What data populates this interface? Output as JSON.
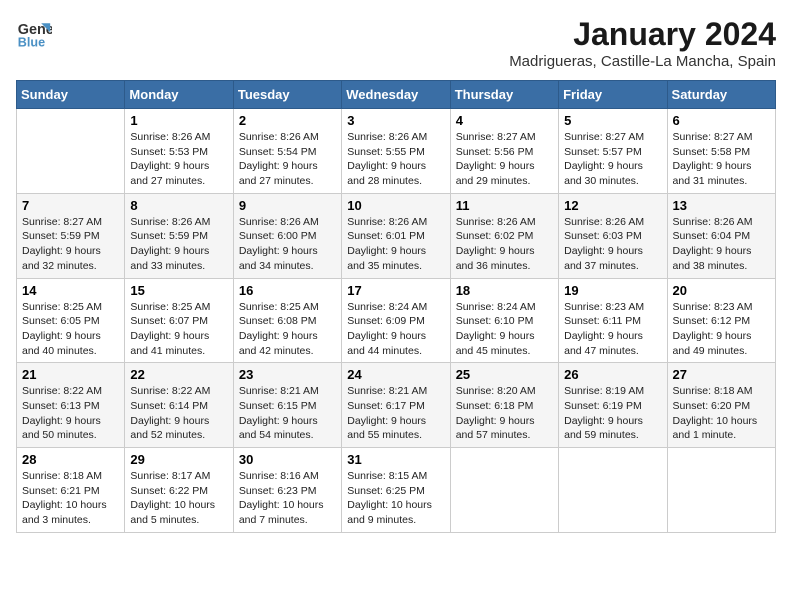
{
  "header": {
    "logo_line1": "General",
    "logo_line2": "Blue",
    "month": "January 2024",
    "location": "Madrigueras, Castille-La Mancha, Spain"
  },
  "days_of_week": [
    "Sunday",
    "Monday",
    "Tuesday",
    "Wednesday",
    "Thursday",
    "Friday",
    "Saturday"
  ],
  "weeks": [
    [
      {
        "day": "",
        "sunrise": "",
        "sunset": "",
        "daylight": ""
      },
      {
        "day": "1",
        "sunrise": "Sunrise: 8:26 AM",
        "sunset": "Sunset: 5:53 PM",
        "daylight": "Daylight: 9 hours and 27 minutes."
      },
      {
        "day": "2",
        "sunrise": "Sunrise: 8:26 AM",
        "sunset": "Sunset: 5:54 PM",
        "daylight": "Daylight: 9 hours and 27 minutes."
      },
      {
        "day": "3",
        "sunrise": "Sunrise: 8:26 AM",
        "sunset": "Sunset: 5:55 PM",
        "daylight": "Daylight: 9 hours and 28 minutes."
      },
      {
        "day": "4",
        "sunrise": "Sunrise: 8:27 AM",
        "sunset": "Sunset: 5:56 PM",
        "daylight": "Daylight: 9 hours and 29 minutes."
      },
      {
        "day": "5",
        "sunrise": "Sunrise: 8:27 AM",
        "sunset": "Sunset: 5:57 PM",
        "daylight": "Daylight: 9 hours and 30 minutes."
      },
      {
        "day": "6",
        "sunrise": "Sunrise: 8:27 AM",
        "sunset": "Sunset: 5:58 PM",
        "daylight": "Daylight: 9 hours and 31 minutes."
      }
    ],
    [
      {
        "day": "7",
        "sunrise": "Sunrise: 8:27 AM",
        "sunset": "Sunset: 5:59 PM",
        "daylight": "Daylight: 9 hours and 32 minutes."
      },
      {
        "day": "8",
        "sunrise": "Sunrise: 8:26 AM",
        "sunset": "Sunset: 5:59 PM",
        "daylight": "Daylight: 9 hours and 33 minutes."
      },
      {
        "day": "9",
        "sunrise": "Sunrise: 8:26 AM",
        "sunset": "Sunset: 6:00 PM",
        "daylight": "Daylight: 9 hours and 34 minutes."
      },
      {
        "day": "10",
        "sunrise": "Sunrise: 8:26 AM",
        "sunset": "Sunset: 6:01 PM",
        "daylight": "Daylight: 9 hours and 35 minutes."
      },
      {
        "day": "11",
        "sunrise": "Sunrise: 8:26 AM",
        "sunset": "Sunset: 6:02 PM",
        "daylight": "Daylight: 9 hours and 36 minutes."
      },
      {
        "day": "12",
        "sunrise": "Sunrise: 8:26 AM",
        "sunset": "Sunset: 6:03 PM",
        "daylight": "Daylight: 9 hours and 37 minutes."
      },
      {
        "day": "13",
        "sunrise": "Sunrise: 8:26 AM",
        "sunset": "Sunset: 6:04 PM",
        "daylight": "Daylight: 9 hours and 38 minutes."
      }
    ],
    [
      {
        "day": "14",
        "sunrise": "Sunrise: 8:25 AM",
        "sunset": "Sunset: 6:05 PM",
        "daylight": "Daylight: 9 hours and 40 minutes."
      },
      {
        "day": "15",
        "sunrise": "Sunrise: 8:25 AM",
        "sunset": "Sunset: 6:07 PM",
        "daylight": "Daylight: 9 hours and 41 minutes."
      },
      {
        "day": "16",
        "sunrise": "Sunrise: 8:25 AM",
        "sunset": "Sunset: 6:08 PM",
        "daylight": "Daylight: 9 hours and 42 minutes."
      },
      {
        "day": "17",
        "sunrise": "Sunrise: 8:24 AM",
        "sunset": "Sunset: 6:09 PM",
        "daylight": "Daylight: 9 hours and 44 minutes."
      },
      {
        "day": "18",
        "sunrise": "Sunrise: 8:24 AM",
        "sunset": "Sunset: 6:10 PM",
        "daylight": "Daylight: 9 hours and 45 minutes."
      },
      {
        "day": "19",
        "sunrise": "Sunrise: 8:23 AM",
        "sunset": "Sunset: 6:11 PM",
        "daylight": "Daylight: 9 hours and 47 minutes."
      },
      {
        "day": "20",
        "sunrise": "Sunrise: 8:23 AM",
        "sunset": "Sunset: 6:12 PM",
        "daylight": "Daylight: 9 hours and 49 minutes."
      }
    ],
    [
      {
        "day": "21",
        "sunrise": "Sunrise: 8:22 AM",
        "sunset": "Sunset: 6:13 PM",
        "daylight": "Daylight: 9 hours and 50 minutes."
      },
      {
        "day": "22",
        "sunrise": "Sunrise: 8:22 AM",
        "sunset": "Sunset: 6:14 PM",
        "daylight": "Daylight: 9 hours and 52 minutes."
      },
      {
        "day": "23",
        "sunrise": "Sunrise: 8:21 AM",
        "sunset": "Sunset: 6:15 PM",
        "daylight": "Daylight: 9 hours and 54 minutes."
      },
      {
        "day": "24",
        "sunrise": "Sunrise: 8:21 AM",
        "sunset": "Sunset: 6:17 PM",
        "daylight": "Daylight: 9 hours and 55 minutes."
      },
      {
        "day": "25",
        "sunrise": "Sunrise: 8:20 AM",
        "sunset": "Sunset: 6:18 PM",
        "daylight": "Daylight: 9 hours and 57 minutes."
      },
      {
        "day": "26",
        "sunrise": "Sunrise: 8:19 AM",
        "sunset": "Sunset: 6:19 PM",
        "daylight": "Daylight: 9 hours and 59 minutes."
      },
      {
        "day": "27",
        "sunrise": "Sunrise: 8:18 AM",
        "sunset": "Sunset: 6:20 PM",
        "daylight": "Daylight: 10 hours and 1 minute."
      }
    ],
    [
      {
        "day": "28",
        "sunrise": "Sunrise: 8:18 AM",
        "sunset": "Sunset: 6:21 PM",
        "daylight": "Daylight: 10 hours and 3 minutes."
      },
      {
        "day": "29",
        "sunrise": "Sunrise: 8:17 AM",
        "sunset": "Sunset: 6:22 PM",
        "daylight": "Daylight: 10 hours and 5 minutes."
      },
      {
        "day": "30",
        "sunrise": "Sunrise: 8:16 AM",
        "sunset": "Sunset: 6:23 PM",
        "daylight": "Daylight: 10 hours and 7 minutes."
      },
      {
        "day": "31",
        "sunrise": "Sunrise: 8:15 AM",
        "sunset": "Sunset: 6:25 PM",
        "daylight": "Daylight: 10 hours and 9 minutes."
      },
      {
        "day": "",
        "sunrise": "",
        "sunset": "",
        "daylight": ""
      },
      {
        "day": "",
        "sunrise": "",
        "sunset": "",
        "daylight": ""
      },
      {
        "day": "",
        "sunrise": "",
        "sunset": "",
        "daylight": ""
      }
    ]
  ]
}
